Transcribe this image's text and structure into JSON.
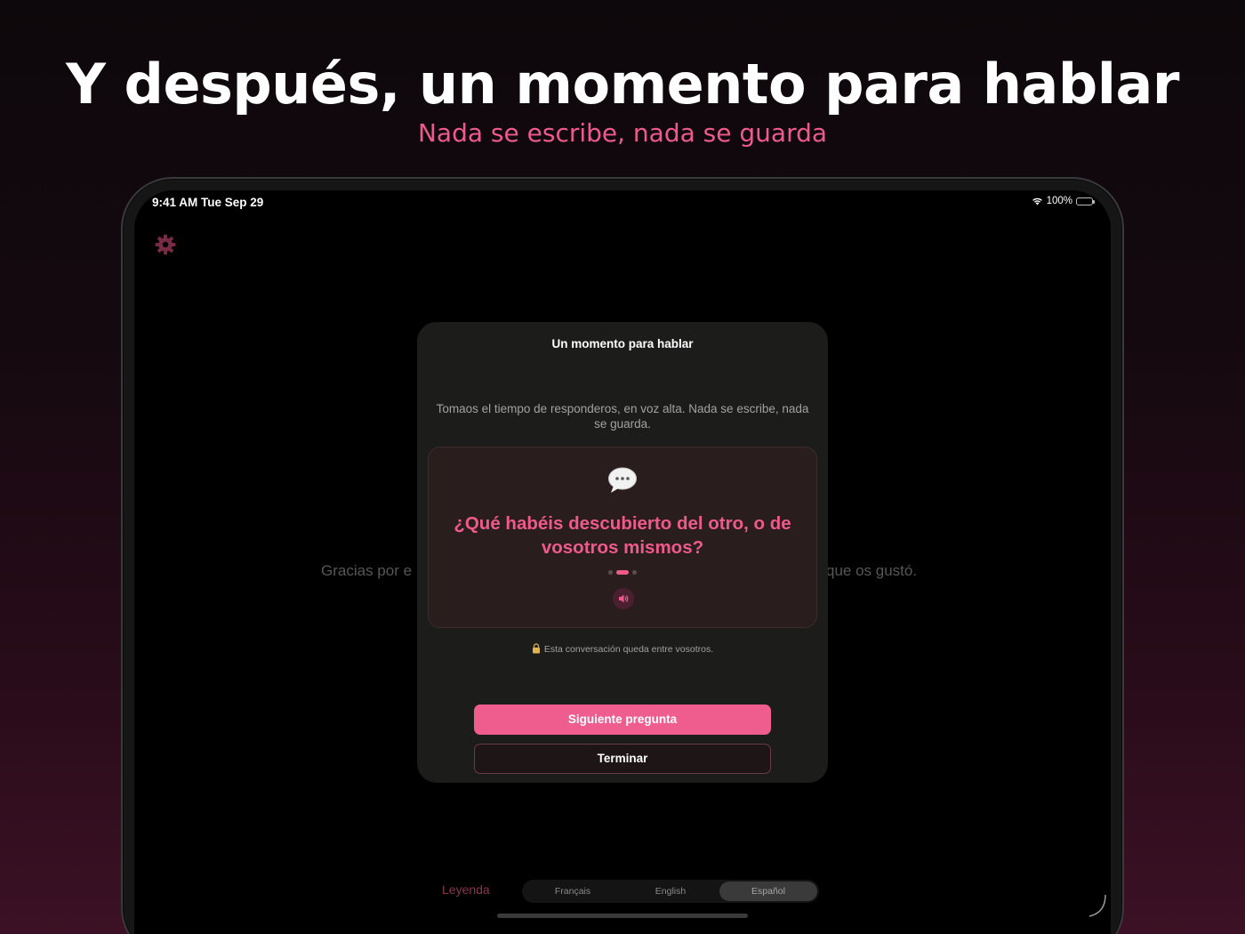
{
  "promo": {
    "headline": "Y después, un momento para hablar",
    "subheadline": "Nada se escribe, nada se guarda"
  },
  "status_bar": {
    "time": "9:41 AM  Tue Sep 29",
    "battery": "100%"
  },
  "background": {
    "text_left": "Gracias por e",
    "text_right": "que os gustó."
  },
  "modal": {
    "title": "Un momento para hablar",
    "description": "Tomaos el tiempo de responderos, en voz alta. Nada se escribe, nada se guarda.",
    "question": "¿Qué habéis descubierto del otro, o de vosotros mismos?",
    "pager": {
      "total": 3,
      "current": 2
    },
    "privacy_note": "Esta conversación queda entre vosotros.",
    "next_button": "Siguiente pregunta",
    "end_button": "Terminar"
  },
  "bottom_bar": {
    "legend_link": "Leyenda",
    "languages": [
      "Français",
      "English",
      "Español"
    ],
    "selected_language": "Español"
  },
  "colors": {
    "accent": "#ee5a8c",
    "modal_bg": "#1c1c1b",
    "card_bg": "#2a1d1e"
  },
  "icons": {
    "settings": "gear-icon",
    "question": "speech-bubble-icon",
    "audio": "speaker-icon",
    "privacy": "lock-icon"
  }
}
